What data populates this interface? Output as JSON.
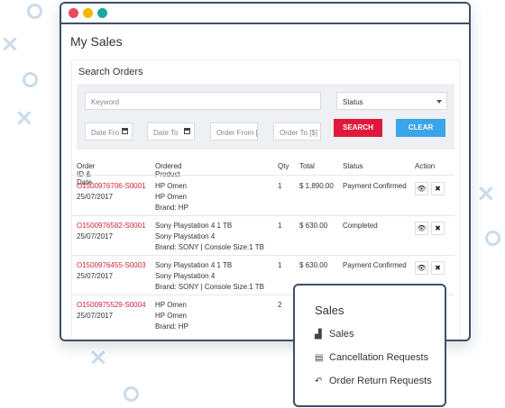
{
  "app": {
    "page_title": "My Sales"
  },
  "search": {
    "heading": "Search Orders",
    "keyword_placeholder": "Keyword",
    "status_label": "Status",
    "date_from": "Date Fro",
    "date_to": "Date To",
    "order_from": "Order From [",
    "order_to": "Order To [$]",
    "search_label": "SEARCH",
    "clear_label": "CLEAR"
  },
  "table": {
    "headers": [
      "Order ID & Date",
      "Ordered Product",
      "Qty",
      "Total",
      "Status",
      "Action"
    ],
    "rows": [
      {
        "id": "O1500976706-S0001",
        "date": "25/07/2017",
        "product": [
          "HP Omen",
          "HP Omen",
          "Brand: HP"
        ],
        "qty": "1",
        "total": "$ 1,890.00",
        "status": "Payment Confirmed"
      },
      {
        "id": "O1500976582-S0001",
        "date": "25/07/2017",
        "product": [
          "Sony Playstation 4 1 TB",
          "Sony Playstation 4",
          "Brand: SONY | Console Size:1 TB"
        ],
        "qty": "1",
        "total": "$ 630.00",
        "status": "Completed"
      },
      {
        "id": "O1500976455-S0003",
        "date": "25/07/2017",
        "product": [
          "Sony Playstation 4 1 TB",
          "Sony Playstation 4",
          "Brand: SONY | Console Size:1 TB"
        ],
        "qty": "1",
        "total": "$ 630.00",
        "status": "Payment Confirmed"
      },
      {
        "id": "O1500975529-S0004",
        "date": "25/07/2017",
        "product": [
          "HP Omen",
          "HP Omen",
          "Brand: HP"
        ],
        "qty": "2",
        "total": "",
        "status": ""
      }
    ]
  },
  "popup": {
    "title": "Sales",
    "items": [
      {
        "label": "Sales",
        "icon": "bar-chart-icon"
      },
      {
        "label": "Cancellation Requests",
        "icon": "document-icon"
      },
      {
        "label": "Order Return Requests",
        "icon": "return-arrow-icon"
      }
    ]
  },
  "colors": {
    "accent_red": "#e0193c",
    "accent_blue": "#3aa5e8",
    "frame": "#3f4f66"
  }
}
